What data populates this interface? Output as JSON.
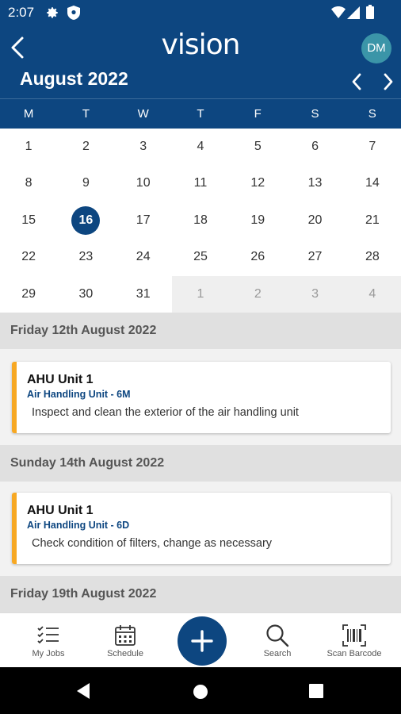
{
  "status_bar": {
    "time": "2:07"
  },
  "header": {
    "logo": "vision",
    "avatar_initials": "DM",
    "month_title": "August 2022"
  },
  "calendar": {
    "weekdays": [
      "M",
      "T",
      "W",
      "T",
      "F",
      "S",
      "S"
    ],
    "weeks": [
      [
        {
          "d": "1"
        },
        {
          "d": "2"
        },
        {
          "d": "3"
        },
        {
          "d": "4"
        },
        {
          "d": "5"
        },
        {
          "d": "6"
        },
        {
          "d": "7"
        }
      ],
      [
        {
          "d": "8"
        },
        {
          "d": "9"
        },
        {
          "d": "10"
        },
        {
          "d": "11"
        },
        {
          "d": "12"
        },
        {
          "d": "13"
        },
        {
          "d": "14"
        }
      ],
      [
        {
          "d": "15"
        },
        {
          "d": "16",
          "selected": true
        },
        {
          "d": "17"
        },
        {
          "d": "18"
        },
        {
          "d": "19"
        },
        {
          "d": "20"
        },
        {
          "d": "21"
        }
      ],
      [
        {
          "d": "22"
        },
        {
          "d": "23"
        },
        {
          "d": "24"
        },
        {
          "d": "25"
        },
        {
          "d": "26"
        },
        {
          "d": "27"
        },
        {
          "d": "28"
        }
      ],
      [
        {
          "d": "29"
        },
        {
          "d": "30"
        },
        {
          "d": "31"
        },
        {
          "d": "1",
          "other": true
        },
        {
          "d": "2",
          "other": true
        },
        {
          "d": "3",
          "other": true
        },
        {
          "d": "4",
          "other": true
        }
      ]
    ]
  },
  "schedule": {
    "sections": [
      {
        "date": "Friday 12th August 2022",
        "jobs": [
          {
            "title": "AHU Unit 1",
            "subtitle": "Air Handling Unit - 6M",
            "description": "Inspect and clean the exterior of the air handling unit"
          }
        ]
      },
      {
        "date": "Sunday 14th August 2022",
        "jobs": [
          {
            "title": "AHU Unit 1",
            "subtitle": "Air Handling Unit - 6D",
            "description": "Check condition of filters, change as necessary"
          }
        ]
      },
      {
        "date": "Friday 19th August 2022",
        "jobs": []
      }
    ]
  },
  "bottom_nav": {
    "my_jobs": "My Jobs",
    "schedule": "Schedule",
    "search": "Search",
    "scan_barcode": "Scan Barcode"
  },
  "colors": {
    "primary": "#0d4680",
    "accent": "#f7a823",
    "avatar": "#3b95a8"
  }
}
